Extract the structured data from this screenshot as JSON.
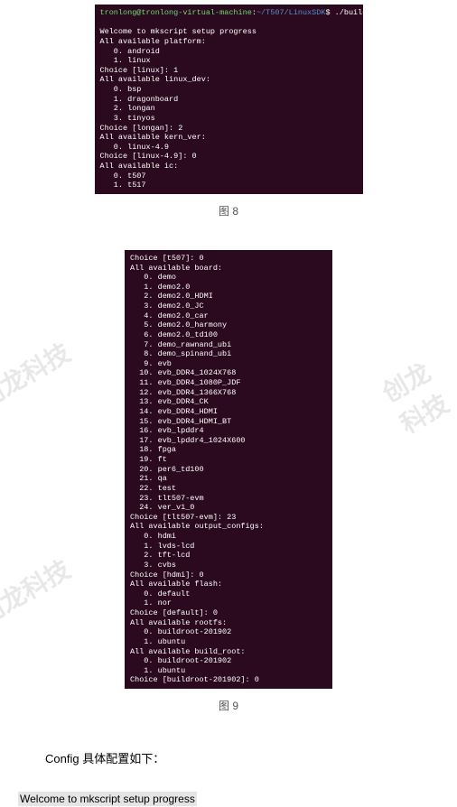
{
  "watermarks": [
    "创龙科技",
    "创龙科技",
    "创龙科技",
    "创龙科技",
    "创龙科技"
  ],
  "terminal1": {
    "prompt_user": "tronlong@tronlong-virtual-machine",
    "prompt_sep1": ":",
    "prompt_path": "~/T507/LinuxSDK",
    "prompt_sep2": "$ ",
    "command": "./build.sh config",
    "lines": [
      "",
      "Welcome to mkscript setup progress",
      "All available platform:",
      "   0. android",
      "   1. linux",
      "Choice [linux]: 1",
      "All available linux_dev:",
      "   0. bsp",
      "   1. dragonboard",
      "   2. longan",
      "   3. tinyos",
      "Choice [longan]: 2",
      "All available kern_ver:",
      "   0. linux-4.9",
      "Choice [linux-4.9]: 0",
      "All available ic:",
      "   0. t507",
      "   1. t517"
    ]
  },
  "caption1": "图  8",
  "terminal2": {
    "lines": [
      "Choice [t507]: 0",
      "All available board:",
      "   0. demo",
      "   1. demo2.0",
      "   2. demo2.0_HDMI",
      "   3. demo2.0_JC",
      "   4. demo2.0_car",
      "   5. demo2.0_harmony",
      "   6. demo2.0_td100",
      "   7. demo_rawnand_ubi",
      "   8. demo_spinand_ubi",
      "   9. evb",
      "  10. evb_DDR4_1024X768",
      "  11. evb_DDR4_1080P_JDF",
      "  12. evb_DDR4_1366X768",
      "  13. evb_DDR4_CK",
      "  14. evb_DDR4_HDMI",
      "  15. evb_DDR4_HDMI_BT",
      "  16. evb_lpddr4",
      "  17. evb_lpddr4_1024X600",
      "  18. fpga",
      "  19. ft",
      "  20. per6_td100",
      "  21. qa",
      "  22. test",
      "  23. tlt507-evm",
      "  24. ver_v1_0",
      "Choice [tlt507-evm]: 23",
      "All available output_configs:",
      "   0. hdmi",
      "   1. lvds-lcd",
      "   2. tft-lcd",
      "   3. cvbs",
      "Choice [hdmi]: 0",
      "All available flash:",
      "   0. default",
      "   1. nor",
      "Choice [default]: 0",
      "All available rootfs:",
      "   0. buildroot-201902",
      "   1. ubuntu",
      "All available build_root:",
      "   0. buildroot-201902",
      "   1. ubuntu",
      "Choice [buildroot-201902]: 0"
    ]
  },
  "caption2": "图  9",
  "section_text": "Config 具体配置如下：",
  "highlight_text": "Welcome to mkscript setup progress"
}
